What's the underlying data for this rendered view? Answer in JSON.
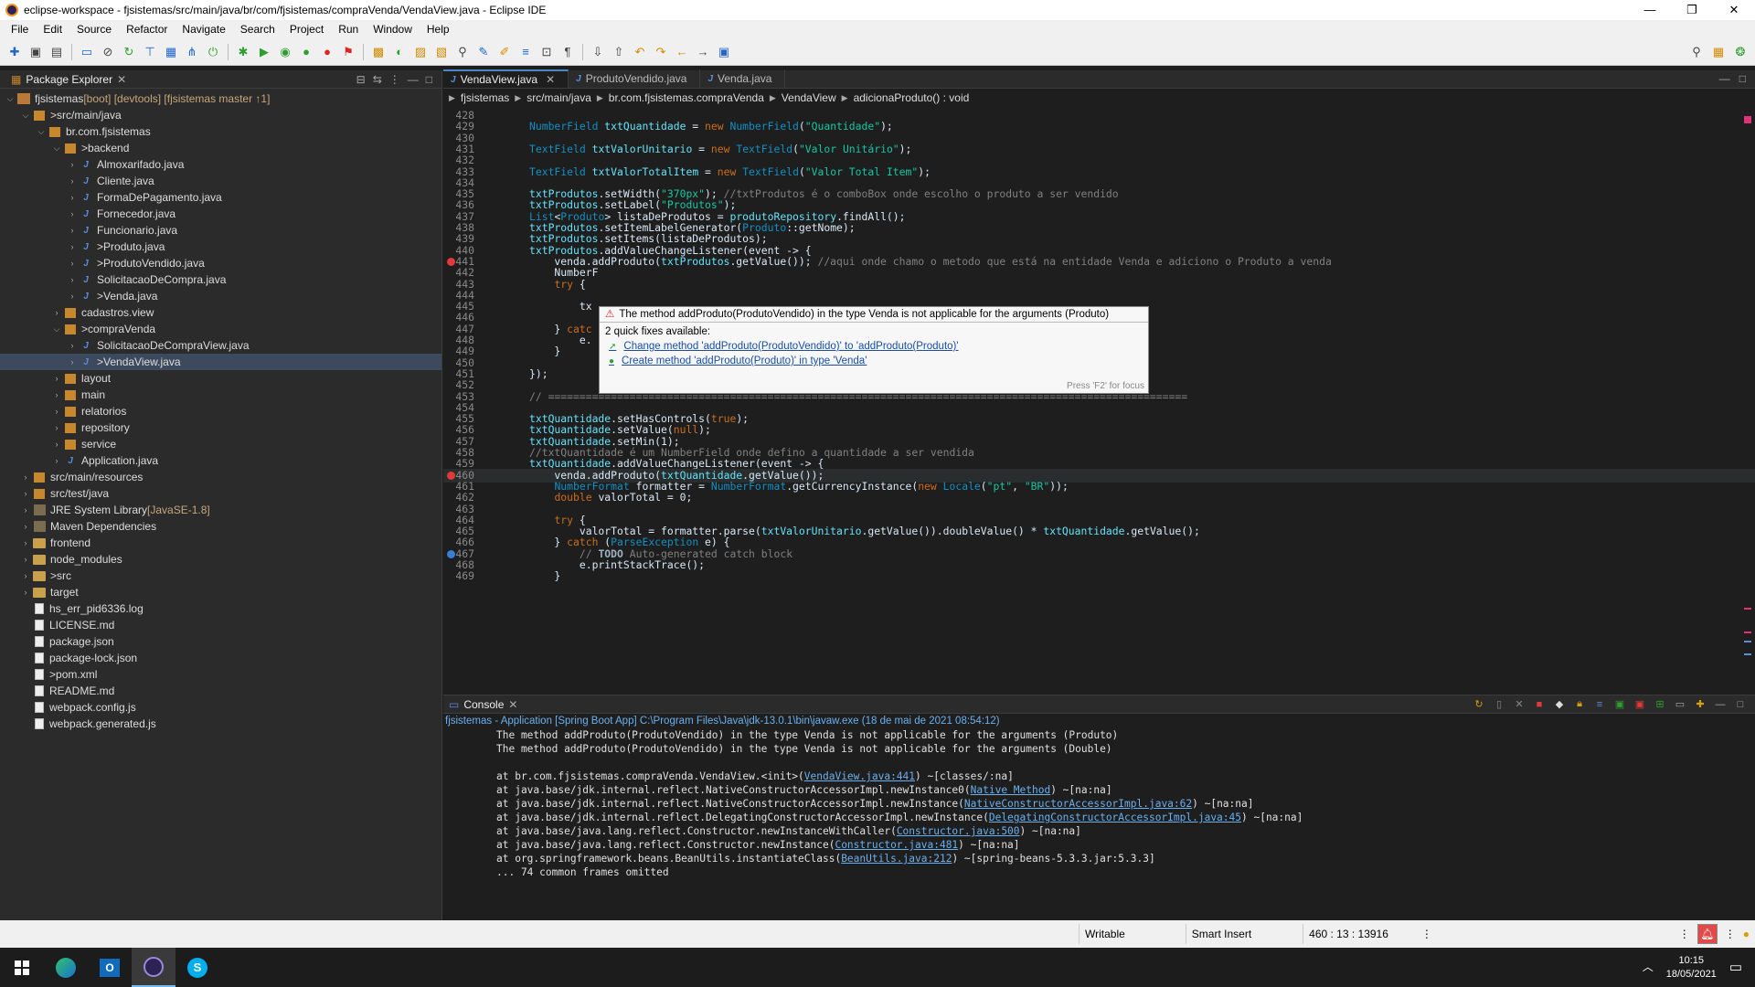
{
  "window": {
    "title": "eclipse-workspace - fjsistemas/src/main/java/br/com/fjsistemas/compraVenda/VendaView.java - Eclipse IDE"
  },
  "menu": [
    "File",
    "Edit",
    "Source",
    "Refactor",
    "Navigate",
    "Search",
    "Project",
    "Run",
    "Window",
    "Help"
  ],
  "explorer": {
    "title": "Package Explorer",
    "items": [
      {
        "label": "fjsistemas",
        "deco": " [boot] [devtools] [fjsistemas master ↑1]",
        "depth": 0,
        "arrow": "v",
        "icon": "proj"
      },
      {
        "label": "src/main/java",
        "depth": 1,
        "arrow": "v",
        "icon": "pkg",
        "prefix": "> "
      },
      {
        "label": "br.com.fjsistemas",
        "depth": 2,
        "arrow": "v",
        "icon": "pkg"
      },
      {
        "label": "backend",
        "depth": 3,
        "arrow": "v",
        "icon": "pkg",
        "prefix": "> "
      },
      {
        "label": "Almoxarifado.java",
        "depth": 4,
        "arrow": ">",
        "icon": "java"
      },
      {
        "label": "Cliente.java",
        "depth": 4,
        "arrow": ">",
        "icon": "java"
      },
      {
        "label": "FormaDePagamento.java",
        "depth": 4,
        "arrow": ">",
        "icon": "java"
      },
      {
        "label": "Fornecedor.java",
        "depth": 4,
        "arrow": ">",
        "icon": "java"
      },
      {
        "label": "Funcionario.java",
        "depth": 4,
        "arrow": ">",
        "icon": "java"
      },
      {
        "label": "Produto.java",
        "depth": 4,
        "arrow": ">",
        "icon": "java",
        "prefix": "> "
      },
      {
        "label": "ProdutoVendido.java",
        "depth": 4,
        "arrow": ">",
        "icon": "java",
        "prefix": "> "
      },
      {
        "label": "SolicitacaoDeCompra.java",
        "depth": 4,
        "arrow": ">",
        "icon": "java"
      },
      {
        "label": "Venda.java",
        "depth": 4,
        "arrow": ">",
        "icon": "java",
        "prefix": "> "
      },
      {
        "label": "cadastros.view",
        "depth": 3,
        "arrow": ">",
        "icon": "pkg"
      },
      {
        "label": "compraVenda",
        "depth": 3,
        "arrow": "v",
        "icon": "pkg",
        "prefix": "> "
      },
      {
        "label": "SolicitacaoDeCompraView.java",
        "depth": 4,
        "arrow": ">",
        "icon": "java"
      },
      {
        "label": "VendaView.java",
        "depth": 4,
        "arrow": ">",
        "icon": "java",
        "prefix": "> ",
        "selected": true
      },
      {
        "label": "layout",
        "depth": 3,
        "arrow": ">",
        "icon": "pkg"
      },
      {
        "label": "main",
        "depth": 3,
        "arrow": ">",
        "icon": "pkg"
      },
      {
        "label": "relatorios",
        "depth": 3,
        "arrow": ">",
        "icon": "pkg"
      },
      {
        "label": "repository",
        "depth": 3,
        "arrow": ">",
        "icon": "pkg"
      },
      {
        "label": "service",
        "depth": 3,
        "arrow": ">",
        "icon": "pkg"
      },
      {
        "label": "Application.java",
        "depth": 3,
        "arrow": ">",
        "icon": "java"
      },
      {
        "label": "src/main/resources",
        "depth": 1,
        "arrow": ">",
        "icon": "pkg"
      },
      {
        "label": "src/test/java",
        "depth": 1,
        "arrow": ">",
        "icon": "pkg"
      },
      {
        "label": "JRE System Library",
        "deco": " [JavaSE-1.8]",
        "depth": 1,
        "arrow": ">",
        "icon": "lib"
      },
      {
        "label": "Maven Dependencies",
        "depth": 1,
        "arrow": ">",
        "icon": "lib"
      },
      {
        "label": "frontend",
        "depth": 1,
        "arrow": ">",
        "icon": "folder"
      },
      {
        "label": "node_modules",
        "depth": 1,
        "arrow": ">",
        "icon": "folder"
      },
      {
        "label": "src",
        "depth": 1,
        "arrow": ">",
        "icon": "folder",
        "prefix": "> "
      },
      {
        "label": "target",
        "depth": 1,
        "arrow": ">",
        "icon": "folder"
      },
      {
        "label": "hs_err_pid6336.log",
        "depth": 1,
        "arrow": "",
        "icon": "file"
      },
      {
        "label": "LICENSE.md",
        "depth": 1,
        "arrow": "",
        "icon": "file"
      },
      {
        "label": "package.json",
        "depth": 1,
        "arrow": "",
        "icon": "file"
      },
      {
        "label": "package-lock.json",
        "depth": 1,
        "arrow": "",
        "icon": "file"
      },
      {
        "label": "pom.xml",
        "depth": 1,
        "arrow": "",
        "icon": "file",
        "prefix": "> "
      },
      {
        "label": "README.md",
        "depth": 1,
        "arrow": "",
        "icon": "file"
      },
      {
        "label": "webpack.config.js",
        "depth": 1,
        "arrow": "",
        "icon": "file"
      },
      {
        "label": "webpack.generated.js",
        "depth": 1,
        "arrow": "",
        "icon": "file"
      }
    ]
  },
  "editor": {
    "tabs": [
      {
        "label": "VendaView.java",
        "active": true
      },
      {
        "label": "ProdutoVendido.java",
        "active": false
      },
      {
        "label": "Venda.java",
        "active": false
      }
    ],
    "breadcrumb": [
      "fjsistemas",
      "src/main/java",
      "br.com.fjsistemas.compraVenda",
      "VendaView",
      "adicionaProduto() : void"
    ],
    "lines": [
      {
        "no": "428",
        "html": ""
      },
      {
        "no": "429",
        "html": "<span class='t'>NumberField</span> <span class='f'>txtQuantidade</span> = <span class='k'>new</span> <span class='t'>NumberField</span>(<span class='s'>\"Quantidade\"</span>);"
      },
      {
        "no": "430",
        "html": ""
      },
      {
        "no": "431",
        "html": "<span class='t'>TextField</span> <span class='f'>txtValorUnitario</span> = <span class='k'>new</span> <span class='t'>TextField</span>(<span class='s'>\"Valor Unitário\"</span>);"
      },
      {
        "no": "432",
        "html": ""
      },
      {
        "no": "433",
        "html": "<span class='t'>TextField</span> <span class='f'>txtValorTotalItem</span> = <span class='k'>new</span> <span class='t'>TextField</span>(<span class='s'>\"Valor Total Item\"</span>);"
      },
      {
        "no": "434",
        "html": ""
      },
      {
        "no": "435",
        "html": "<span class='f'>txtProdutos</span>.setWidth(<span class='s'>\"370px\"</span>); <span class='c'>//txtProdutos é o comboBox onde escolho o produto a ser vendido</span>"
      },
      {
        "no": "436",
        "html": "<span class='f'>txtProdutos</span>.setLabel(<span class='s'>\"Produtos\"</span>);"
      },
      {
        "no": "437",
        "html": "<span class='t'>List</span>&lt;<span class='t'>Produto</span>&gt; listaDeProdutos = <span class='f'>produtoRepository</span>.findAll();"
      },
      {
        "no": "438",
        "html": "<span class='f'>txtProdutos</span>.setItemLabelGenerator(<span class='t'>Produto</span>::getNome);"
      },
      {
        "no": "439",
        "html": "<span class='f'>txtProdutos</span>.setItems(listaDeProdutos);"
      },
      {
        "no": "440",
        "html": "<span class='f'>txtProdutos</span>.addValueChangeListener(event -&gt; {"
      },
      {
        "no": "441",
        "html": "    venda.addProduto(<span class='f'>txtProdutos</span>.getValue()); <span class='c'>//aqui onde chamo o metodo que está na entidade Venda e adiciono o Produto a venda</span>",
        "err": true
      },
      {
        "no": "442",
        "html": "    NumberF"
      },
      {
        "no": "443",
        "html": "    <span class='k'>try</span> {"
      },
      {
        "no": "444",
        "html": ""
      },
      {
        "no": "445",
        "html": "        tx"
      },
      {
        "no": "446",
        "html": ""
      },
      {
        "no": "447",
        "html": "    } <span class='k'>catc</span>"
      },
      {
        "no": "448",
        "html": "        e."
      },
      {
        "no": "449",
        "html": "    }"
      },
      {
        "no": "450",
        "html": ""
      },
      {
        "no": "451",
        "html": "});"
      },
      {
        "no": "452",
        "html": ""
      },
      {
        "no": "453",
        "html": "<span class='c'>// ======================================================================================================</span>"
      },
      {
        "no": "454",
        "html": ""
      },
      {
        "no": "455",
        "html": "<span class='f'>txtQuantidade</span>.setHasControls(<span class='k'>true</span>);"
      },
      {
        "no": "456",
        "html": "<span class='f'>txtQuantidade</span>.setValue(<span class='k'>null</span>);"
      },
      {
        "no": "457",
        "html": "<span class='f'>txtQuantidade</span>.setMin(1);"
      },
      {
        "no": "458",
        "html": "<span class='c'>//txtQuantidade é um NumberField onde defino a quantidade a ser vendida</span>"
      },
      {
        "no": "459",
        "html": "<span class='f'>txtQuantidade</span>.addValueChangeListener(event -&gt; {"
      },
      {
        "no": "460",
        "html": "    venda.addProduto(<span class='f'>txtQuantidade</span>.getValue());",
        "err": true,
        "cur": true
      },
      {
        "no": "461",
        "html": "    <span class='t'>NumberFormat</span> formatter = <span class='t'>NumberFormat</span>.getCurrencyInstance(<span class='k'>new</span> <span class='t'>Locale</span>(<span class='s'>\"pt\"</span>, <span class='s'>\"BR\"</span>));"
      },
      {
        "no": "462",
        "html": "    <span class='k'>double</span> valorTotal = 0;"
      },
      {
        "no": "463",
        "html": ""
      },
      {
        "no": "464",
        "html": "    <span class='k'>try</span> {"
      },
      {
        "no": "465",
        "html": "        valorTotal = formatter.parse(<span class='f'>txtValorUnitario</span>.getValue()).doubleValue() * <span class='f'>txtQuantidade</span>.getValue();"
      },
      {
        "no": "466",
        "html": "    } <span class='k'>catch</span> (<span class='t'>ParseException</span> e) {"
      },
      {
        "no": "467",
        "html": "        <span class='c'>// </span><span class='todo'>TODO</span><span class='c'> Auto-generated catch block</span>",
        "bp": true
      },
      {
        "no": "468",
        "html": "        e.printStackTrace();"
      },
      {
        "no": "469",
        "html": "    }"
      }
    ]
  },
  "quickfix": {
    "message": "The method addProduto(ProdutoVendido) in the type Venda is not applicable for the arguments (Produto)",
    "count_label": "2 quick fixes available:",
    "fixes": [
      "Change method 'addProduto(ProdutoVendido)' to 'addProduto(Produto)'",
      "Create method 'addProduto(Produto)' in type 'Venda'"
    ],
    "footer": "Press 'F2' for focus"
  },
  "console": {
    "title": "Console",
    "description": "fjsistemas - Application [Spring Boot App] C:\\Program Files\\Java\\jdk-13.0.1\\bin\\javaw.exe  (18 de mai de 2021 08:54:12)",
    "lines": [
      {
        "pre": "The method addProduto(ProdutoVendido) in the type Venda is not applicable for the arguments (Produto)"
      },
      {
        "pre": "The method addProduto(ProdutoVendido) in the type Venda is not applicable for the arguments (Double)"
      },
      {
        "pre": ""
      },
      {
        "pre": "at br.com.fjsistemas.compraVenda.VendaView.<init>(",
        "link": "VendaView.java:441",
        "post": ") ~[classes/:na]"
      },
      {
        "pre": "at java.base/jdk.internal.reflect.NativeConstructorAccessorImpl.newInstance0(",
        "link": "Native Method",
        "post": ") ~[na:na]"
      },
      {
        "pre": "at java.base/jdk.internal.reflect.NativeConstructorAccessorImpl.newInstance(",
        "link": "NativeConstructorAccessorImpl.java:62",
        "post": ") ~[na:na]"
      },
      {
        "pre": "at java.base/jdk.internal.reflect.DelegatingConstructorAccessorImpl.newInstance(",
        "link": "DelegatingConstructorAccessorImpl.java:45",
        "post": ") ~[na:na]"
      },
      {
        "pre": "at java.base/java.lang.reflect.Constructor.newInstanceWithCaller(",
        "link": "Constructor.java:500",
        "post": ") ~[na:na]"
      },
      {
        "pre": "at java.base/java.lang.reflect.Constructor.newInstance(",
        "link": "Constructor.java:481",
        "post": ") ~[na:na]"
      },
      {
        "pre": "at org.springframework.beans.BeanUtils.instantiateClass(",
        "link": "BeanUtils.java:212",
        "post": ") ~[spring-beans-5.3.3.jar:5.3.3]"
      },
      {
        "pre": "... 74 common frames omitted"
      }
    ]
  },
  "status": {
    "writable": "Writable",
    "insert_mode": "Smart Insert",
    "position": "460 : 13 : 13916"
  },
  "taskbar": {
    "time": "10:15",
    "date": "18/05/2021"
  }
}
